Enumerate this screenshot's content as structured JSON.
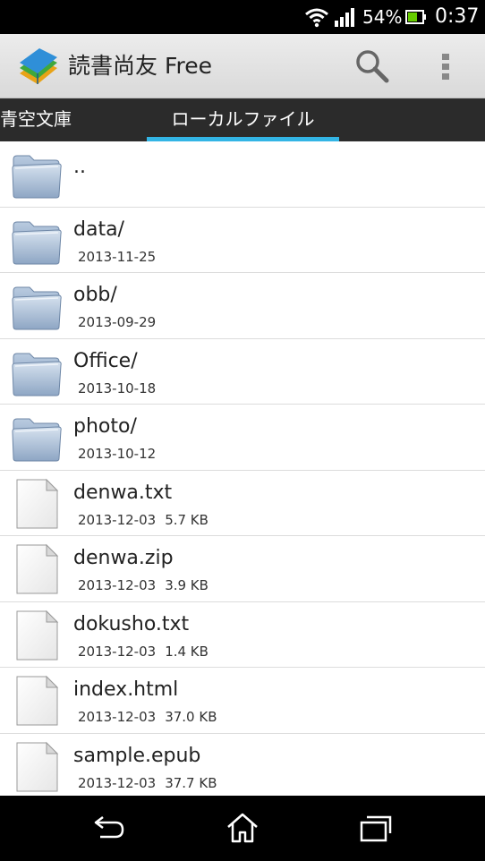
{
  "status_bar": {
    "battery_percent": "54%",
    "time": "0:37",
    "icons": [
      "wifi-icon",
      "signal-icon",
      "battery-icon"
    ]
  },
  "action_bar": {
    "title": "読書尚友 Free",
    "icons": [
      "app-book-icon",
      "search-icon",
      "overflow-menu-icon"
    ]
  },
  "tabs": [
    {
      "label": "青空文庫",
      "selected": false
    },
    {
      "label": "ローカルファイル",
      "selected": true
    }
  ],
  "colors": {
    "tab_indicator": "#33b5e5",
    "action_bar": "#e3e3e3",
    "tab_bar": "#2b2b2b"
  },
  "files": [
    {
      "name": "..",
      "date": "",
      "size": "",
      "kind": "folder"
    },
    {
      "name": "data/",
      "date": "2013-11-25",
      "size": "",
      "kind": "folder"
    },
    {
      "name": "obb/",
      "date": "2013-09-29",
      "size": "",
      "kind": "folder"
    },
    {
      "name": "Office/",
      "date": "2013-10-18",
      "size": "",
      "kind": "folder"
    },
    {
      "name": "photo/",
      "date": "2013-10-12",
      "size": "",
      "kind": "folder"
    },
    {
      "name": "denwa.txt",
      "date": "2013-12-03",
      "size": "5.7 KB",
      "kind": "file"
    },
    {
      "name": "denwa.zip",
      "date": "2013-12-03",
      "size": "3.9 KB",
      "kind": "file"
    },
    {
      "name": "dokusho.txt",
      "date": "2013-12-03",
      "size": "1.4 KB",
      "kind": "file"
    },
    {
      "name": "index.html",
      "date": "2013-12-03",
      "size": "37.0 KB",
      "kind": "file"
    },
    {
      "name": "sample.epub",
      "date": "2013-12-03",
      "size": "37.7 KB",
      "kind": "file"
    }
  ],
  "nav_bar": {
    "icons": [
      "back-icon",
      "home-icon",
      "recent-apps-icon"
    ]
  }
}
